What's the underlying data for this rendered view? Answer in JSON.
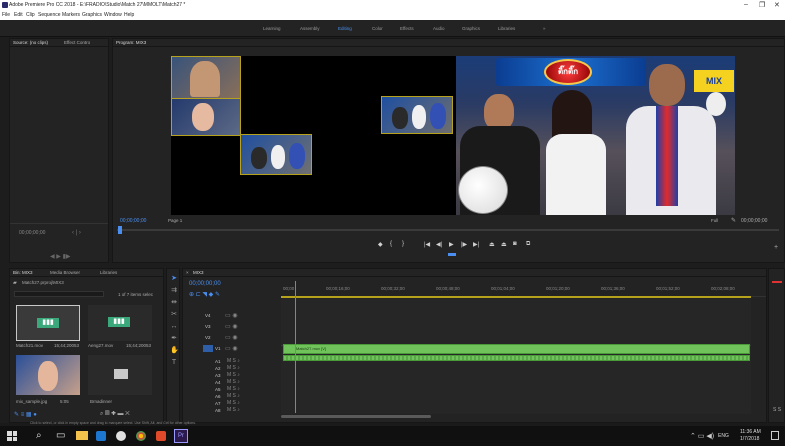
{
  "window": {
    "title": "Adobe Premiere Pro CC 2018 - E:\\FRADIO\\Studio\\Match 27\\MMOLT\\Match27 *",
    "controls": [
      "–",
      "❐",
      "✕"
    ]
  },
  "menu": [
    "File",
    "Edit",
    "Clip",
    "Sequence",
    "Markers",
    "Graphics",
    "Window",
    "Help"
  ],
  "workspaces": {
    "items": [
      "Learning",
      "Assembly",
      "Editing",
      "Color",
      "Effects",
      "Audio",
      "Graphics",
      "Libraries"
    ],
    "active": "Editing",
    "more": "»"
  },
  "source_panel": {
    "tabs": [
      "Source: (no clips)",
      "Effect Contro"
    ],
    "timecode": "00;00;00;00"
  },
  "program_panel": {
    "tab": "Program: MIX3",
    "menu_icon": "≡",
    "timecode_left": "00;00;00;00",
    "fit": "Fit",
    "page": "Page 1",
    "timecode_right": "00;00;00;00",
    "fit_right": "Full",
    "logo_text": "ติ๊กติ๊ก",
    "mix_text": "MIX"
  },
  "project_panel": {
    "tabs": [
      "Bin: MIX3",
      "Media Browser",
      "Libraries"
    ],
    "bin_path": "Match27.prproj\\MIX3",
    "item_count": "1 of 7 items selec",
    "items": [
      {
        "name": "Match21.mov",
        "duration": "15;44;20053"
      },
      {
        "name": "Aeng27.mov",
        "duration": "15;44;20053"
      },
      {
        "name": "mix_sample.jpg",
        "duration": "5:05"
      },
      {
        "name": "Brnadinner",
        "duration": ""
      }
    ]
  },
  "timeline": {
    "tab": "MIX3",
    "timecode": "00;00;00;00",
    "ruler": [
      "00;00",
      "00;00;16;00",
      "00;00;32;00",
      "00;00;48;00",
      "00;01;04;00",
      "00;01;20;00",
      "00;01;36;00",
      "00;01;52;00",
      "00;02;08;00"
    ],
    "video_tracks": [
      "V4",
      "V3",
      "V2",
      "V1"
    ],
    "audio_tracks": [
      "A1",
      "A2",
      "A3",
      "A4",
      "A5",
      "A6",
      "A7",
      "A8"
    ],
    "clip_label": "Match27.mov [V]"
  },
  "status_text": "Click to select, or click in empty space and drag to marquee select. Use Shift, Alt, and Ctrl for other options.",
  "taskbar": {
    "time": "11:36 AM",
    "date": "1/7/2018",
    "lang": "ENG"
  },
  "colors": {
    "accent": "#4a8ff0",
    "clip_green": "#6fc35a",
    "pip_border": "#b7a21d",
    "premiere": "#9999ff"
  }
}
